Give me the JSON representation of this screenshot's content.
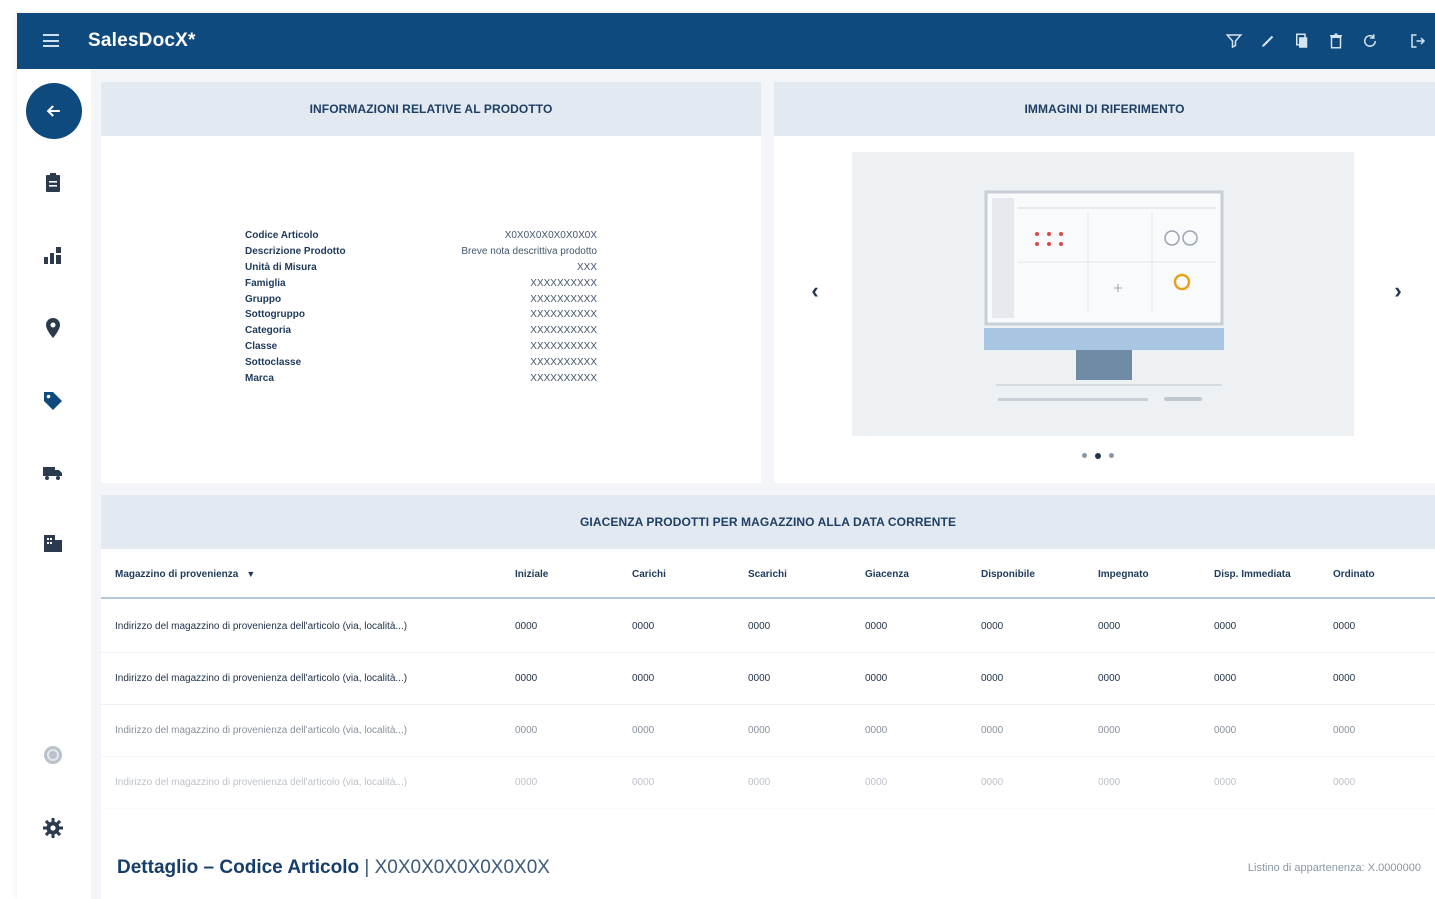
{
  "app": {
    "name": "SalesDocX*"
  },
  "toolbar_icons": [
    "filter-icon",
    "edit-icon",
    "copy-icon",
    "delete-icon",
    "refresh-icon",
    "logout-icon"
  ],
  "sidebar_icons": [
    "back-arrow-icon",
    "clipboard-icon",
    "chart-icon",
    "location-pin-icon",
    "tag-icon",
    "truck-icon",
    "building-icon",
    "circle-icon",
    "gear-icon"
  ],
  "product_info": {
    "title": "INFORMAZIONI RELATIVE AL PRODOTTO",
    "rows": [
      {
        "label": "Codice Articolo",
        "value": "X0X0X0X0X0X0X0X"
      },
      {
        "label": "Descrizione Prodotto",
        "value": "Breve nota descrittiva prodotto"
      },
      {
        "label": "Unità di Misura",
        "value": "XXX"
      },
      {
        "label": "Famiglia",
        "value": "XXXXXXXXXX"
      },
      {
        "label": "Gruppo",
        "value": "XXXXXXXXXX"
      },
      {
        "label": "Sottogruppo",
        "value": "XXXXXXXXXX"
      },
      {
        "label": "Categoria",
        "value": "XXXXXXXXXX"
      },
      {
        "label": "Classe",
        "value": "XXXXXXXXXX"
      },
      {
        "label": "Sottoclasse",
        "value": "XXXXXXXXXX"
      },
      {
        "label": "Marca",
        "value": "XXXXXXXXXX"
      }
    ]
  },
  "images": {
    "title": "IMMAGINI DI RIFERIMENTO",
    "prev": "‹",
    "next": "›",
    "dot_count": 3,
    "active_dot": 1
  },
  "stock": {
    "title": "GIACENZA PRODOTTI PER MAGAZZINO ALLA DATA CORRENTE",
    "columns": [
      "Magazzino di provenienza",
      "Iniziale",
      "Carichi",
      "Scarichi",
      "Giacenza",
      "Disponibile",
      "Impegnato",
      "Disp. Immediata",
      "Ordinato"
    ],
    "rows": [
      [
        "Indirizzo del magazzino di provenienza dell'articolo (via, località...)",
        "0000",
        "0000",
        "0000",
        "0000",
        "0000",
        "0000",
        "0000",
        "0000"
      ],
      [
        "Indirizzo del magazzino di provenienza dell'articolo (via, località...)",
        "0000",
        "0000",
        "0000",
        "0000",
        "0000",
        "0000",
        "0000",
        "0000"
      ],
      [
        "Indirizzo del magazzino di provenienza dell'articolo (via, località...)",
        "0000",
        "0000",
        "0000",
        "0000",
        "0000",
        "0000",
        "0000",
        "0000"
      ],
      [
        "Indirizzo del magazzino di provenienza dell'articolo (via, località...)",
        "0000",
        "0000",
        "0000",
        "0000",
        "0000",
        "0000",
        "0000",
        "0000"
      ]
    ],
    "row_opacity": [
      1,
      1,
      0.55,
      0.3
    ]
  },
  "footer": {
    "title": "Dettaglio – Codice Articolo",
    "separator": "|",
    "code": "X0X0X0X0X0X0X0X",
    "listino": "Listino di appartenenza: X.0000000"
  }
}
